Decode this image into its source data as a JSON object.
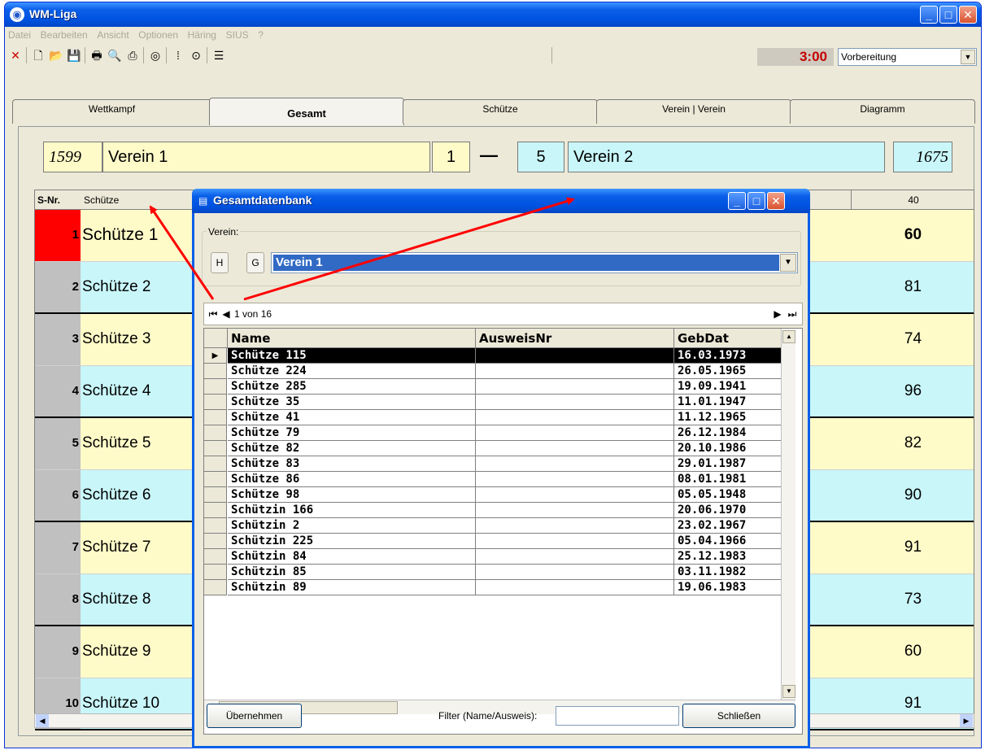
{
  "window": {
    "title": "WM-Liga",
    "icon": "globe-icon",
    "controls": [
      "minimize-icon",
      "maximize-icon",
      "close-icon"
    ]
  },
  "menu": [
    "Datei",
    "Bearbeiten",
    "Ansicht",
    "Optionen",
    "Häring",
    "SIUS",
    "?"
  ],
  "toolbar": {
    "icons": [
      "close-x-icon",
      "new-document-icon",
      "open-folder-icon",
      "save-icon",
      "print-icon",
      "print-preview-icon",
      "print-setup-icon",
      "target-icon",
      "shooter-icon",
      "aim-icon",
      "stack-icon"
    ],
    "timer": "3:00",
    "phase": "Vorbereitung"
  },
  "tabs": [
    "Wettkampf",
    "Gesamt",
    "Schütze",
    "Verein | Verein",
    "Diagramm"
  ],
  "active_tab": "Gesamt",
  "score": {
    "left_total": "1599",
    "left_team": "Verein 1",
    "left_points": "1",
    "separator": "—",
    "right_points": "5",
    "right_team": "Verein 2",
    "right_total": "1675"
  },
  "grid": {
    "headers": {
      "nr": "S-Nr.",
      "name": "Schütze",
      "last": "40"
    },
    "rows": [
      {
        "nr": "1",
        "name": "Schütze 1",
        "value": "60",
        "color": "yellow",
        "highlight": true
      },
      {
        "nr": "2",
        "name": "Schütze 2",
        "value": "81",
        "color": "cyan"
      },
      {
        "nr": "3",
        "name": "Schütze 3",
        "value": "74",
        "color": "yellow"
      },
      {
        "nr": "4",
        "name": "Schütze 4",
        "value": "96",
        "color": "cyan"
      },
      {
        "nr": "5",
        "name": "Schütze 5",
        "value": "82",
        "color": "yellow"
      },
      {
        "nr": "6",
        "name": "Schütze 6",
        "value": "90",
        "color": "cyan"
      },
      {
        "nr": "7",
        "name": "Schütze 7",
        "value": "91",
        "color": "yellow"
      },
      {
        "nr": "8",
        "name": "Schütze 8",
        "value": "73",
        "color": "cyan"
      },
      {
        "nr": "9",
        "name": "Schütze 9",
        "value": "60",
        "color": "yellow"
      },
      {
        "nr": "10",
        "name": "Schütze 10",
        "value": "91",
        "color": "cyan"
      }
    ]
  },
  "dialog": {
    "title": "Gesamtdatenbank",
    "group_label": "Verein:",
    "btn_h": "H",
    "btn_g": "G",
    "verein_selected": "Verein 1",
    "nav_text": "1 von 16",
    "columns": [
      "Name",
      "AusweisNr",
      "GebDat"
    ],
    "rows": [
      {
        "name": "Schütze 115",
        "ausweis": "",
        "gebdat": "16.03.1973"
      },
      {
        "name": "Schütze 224",
        "ausweis": "",
        "gebdat": "26.05.1965"
      },
      {
        "name": "Schütze 285",
        "ausweis": "",
        "gebdat": "19.09.1941"
      },
      {
        "name": "Schütze 35",
        "ausweis": "",
        "gebdat": "11.01.1947"
      },
      {
        "name": "Schütze 41",
        "ausweis": "",
        "gebdat": "11.12.1965"
      },
      {
        "name": "Schütze 79",
        "ausweis": "",
        "gebdat": "26.12.1984"
      },
      {
        "name": "Schütze 82",
        "ausweis": "",
        "gebdat": "20.10.1986"
      },
      {
        "name": "Schütze 83",
        "ausweis": "",
        "gebdat": "29.01.1987"
      },
      {
        "name": "Schütze 86",
        "ausweis": "",
        "gebdat": "08.01.1981"
      },
      {
        "name": "Schütze 98",
        "ausweis": "",
        "gebdat": "05.05.1948"
      },
      {
        "name": "Schützin 166",
        "ausweis": "",
        "gebdat": "20.06.1970"
      },
      {
        "name": "Schützin 2",
        "ausweis": "",
        "gebdat": "23.02.1967"
      },
      {
        "name": "Schützin 225",
        "ausweis": "",
        "gebdat": "05.04.1966"
      },
      {
        "name": "Schützin 84",
        "ausweis": "",
        "gebdat": "25.12.1983"
      },
      {
        "name": "Schützin 85",
        "ausweis": "",
        "gebdat": "03.11.1982"
      },
      {
        "name": "Schützin 89",
        "ausweis": "",
        "gebdat": "19.06.1983"
      }
    ],
    "filter_label": "Filter (Name/Ausweis):",
    "filter_value": "",
    "btn_accept": "Übernehmen",
    "btn_close": "Schließen"
  },
  "colors": {
    "yellow_row": "#fffbc9",
    "cyan_row": "#c9f6f9",
    "highlight": "#ff0000",
    "selection": "#316ac5",
    "annotation_arrow": "#ff0000"
  }
}
